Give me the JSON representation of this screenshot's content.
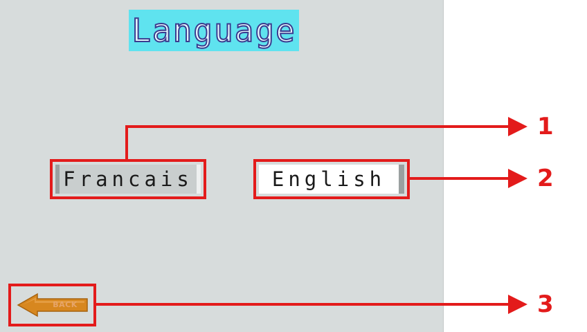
{
  "screen": {
    "title": "Language",
    "buttons": {
      "francais": "Francais",
      "english": "English"
    },
    "back_label": "BACK",
    "back_icon": "arrow-left-icon"
  },
  "callouts": [
    "1",
    "2",
    "3"
  ],
  "colors": {
    "screen_bg": "#d7dcdc",
    "title_bg": "#5fe3ef",
    "callout_red": "#e31b1b",
    "back_arrow": "#d7871f"
  }
}
